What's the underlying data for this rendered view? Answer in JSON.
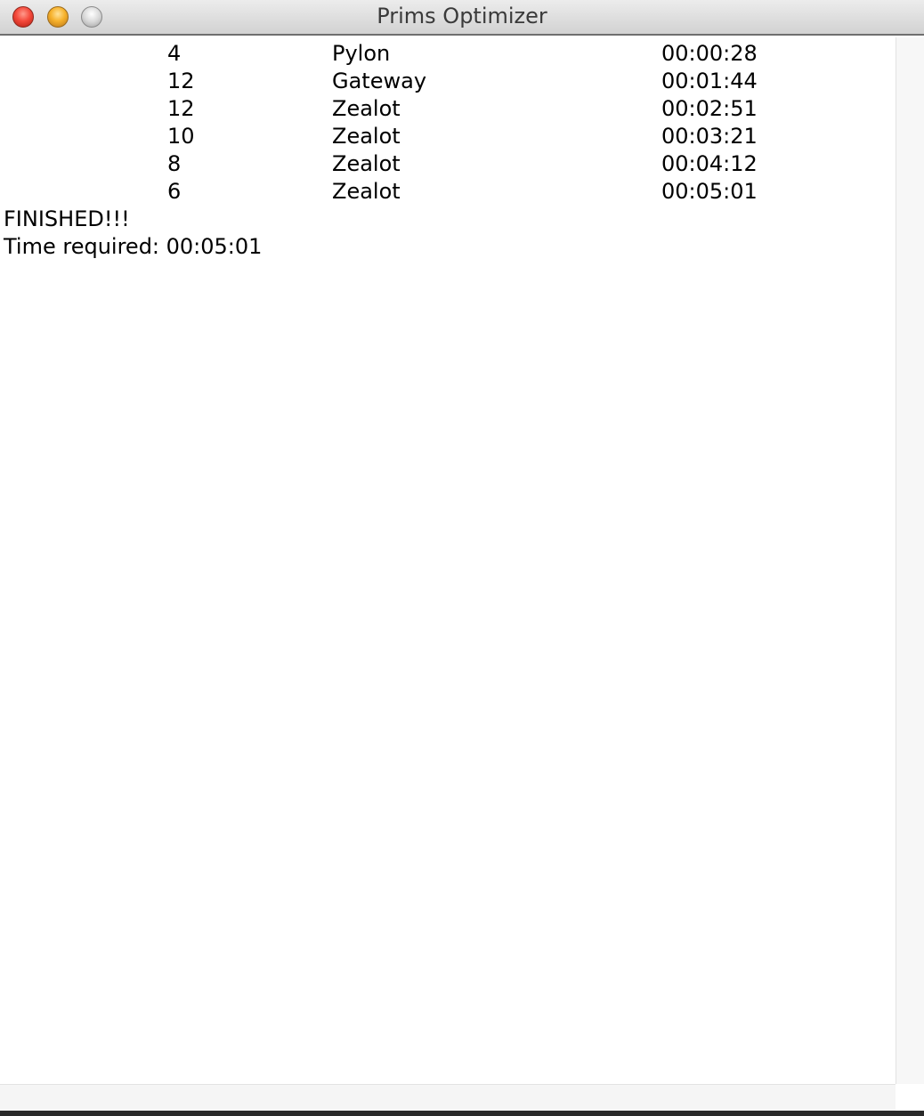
{
  "window": {
    "title": "Prims Optimizer"
  },
  "log": {
    "rows": [
      {
        "count": "4",
        "unit": "Pylon",
        "time": "00:00:28"
      },
      {
        "count": "12",
        "unit": "Gateway",
        "time": "00:01:44"
      },
      {
        "count": "12",
        "unit": "Zealot",
        "time": "00:02:51"
      },
      {
        "count": "10",
        "unit": "Zealot",
        "time": "00:03:21"
      },
      {
        "count": "8",
        "unit": "Zealot",
        "time": "00:04:12"
      },
      {
        "count": "6",
        "unit": "Zealot",
        "time": "00:05:01"
      }
    ],
    "finished_text": "FINISHED!!!",
    "time_required_text": "Time required: 00:05:01"
  }
}
